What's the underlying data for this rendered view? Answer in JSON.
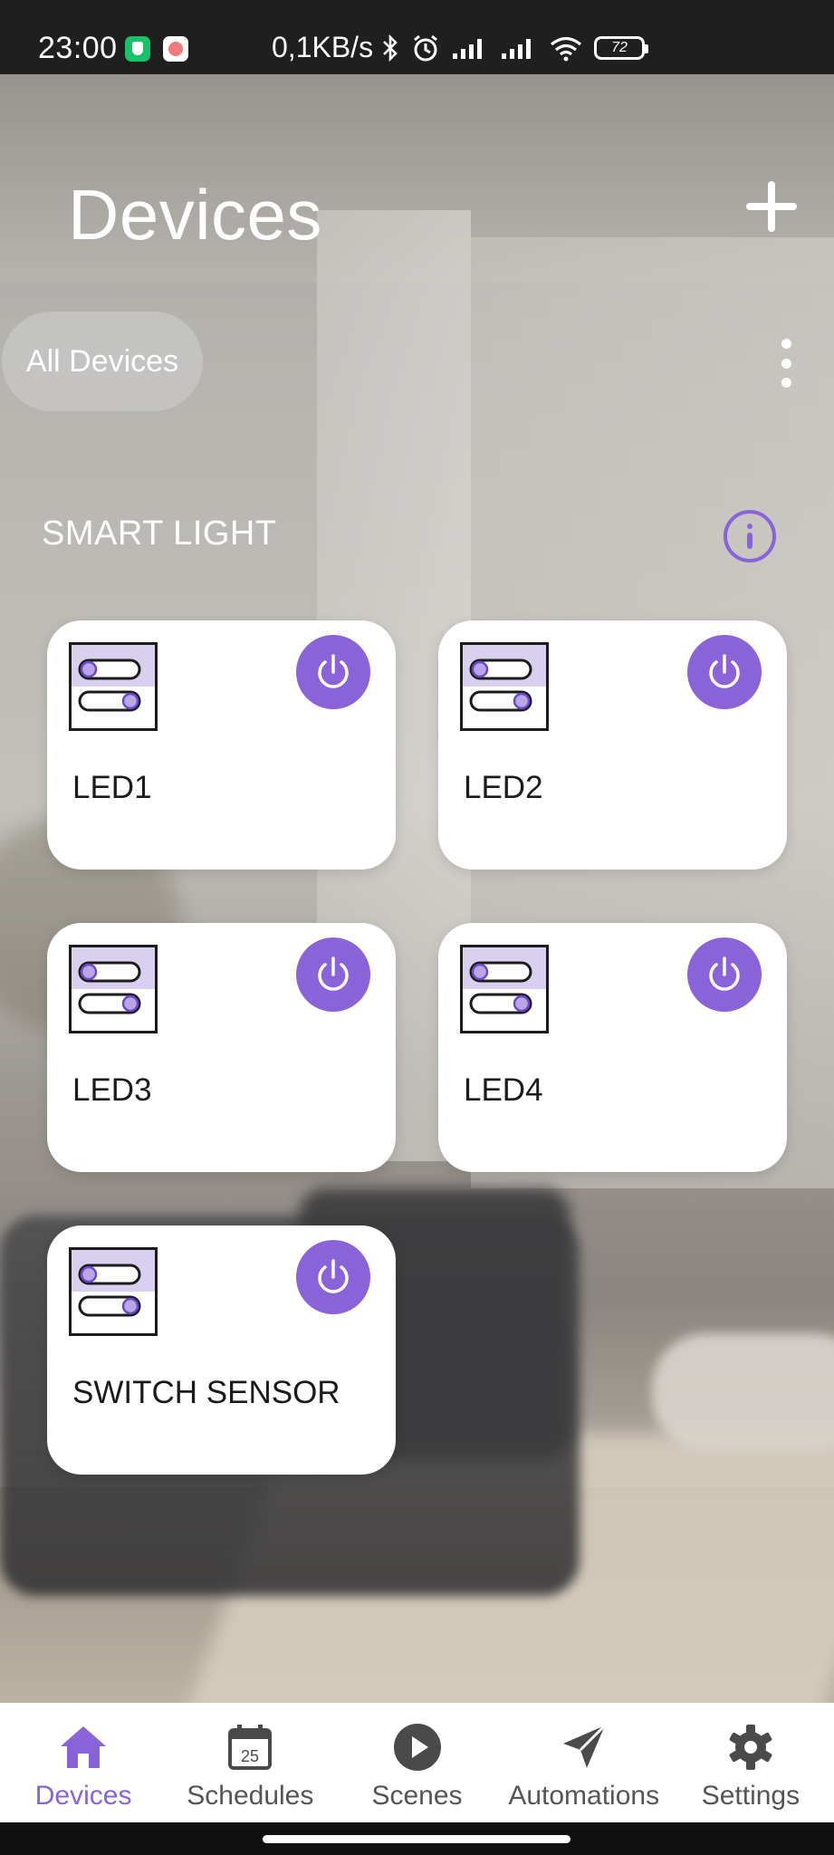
{
  "status_bar": {
    "time": "23:00",
    "network_speed": "0,1KB/s",
    "battery": "72"
  },
  "header": {
    "title": "Devices"
  },
  "filter": {
    "selected": "All Devices"
  },
  "section": {
    "title": "SMART LIGHT"
  },
  "devices": [
    {
      "label": "LED1",
      "on": true
    },
    {
      "label": "LED2",
      "on": true
    },
    {
      "label": "LED3",
      "on": true
    },
    {
      "label": "LED4",
      "on": true
    },
    {
      "label": "SWITCH SENSOR",
      "on": true
    }
  ],
  "bottom_nav": [
    {
      "label": "Devices",
      "icon": "home-icon",
      "active": true
    },
    {
      "label": "Schedules",
      "icon": "calendar-icon",
      "active": false,
      "badge": "25"
    },
    {
      "label": "Scenes",
      "icon": "play-icon",
      "active": false
    },
    {
      "label": "Automations",
      "icon": "send-icon",
      "active": false
    },
    {
      "label": "Settings",
      "icon": "gear-icon",
      "active": false
    }
  ],
  "colors": {
    "accent": "#8a63d8",
    "card": "#ffffff",
    "status_bar": "#1f1f1f"
  }
}
